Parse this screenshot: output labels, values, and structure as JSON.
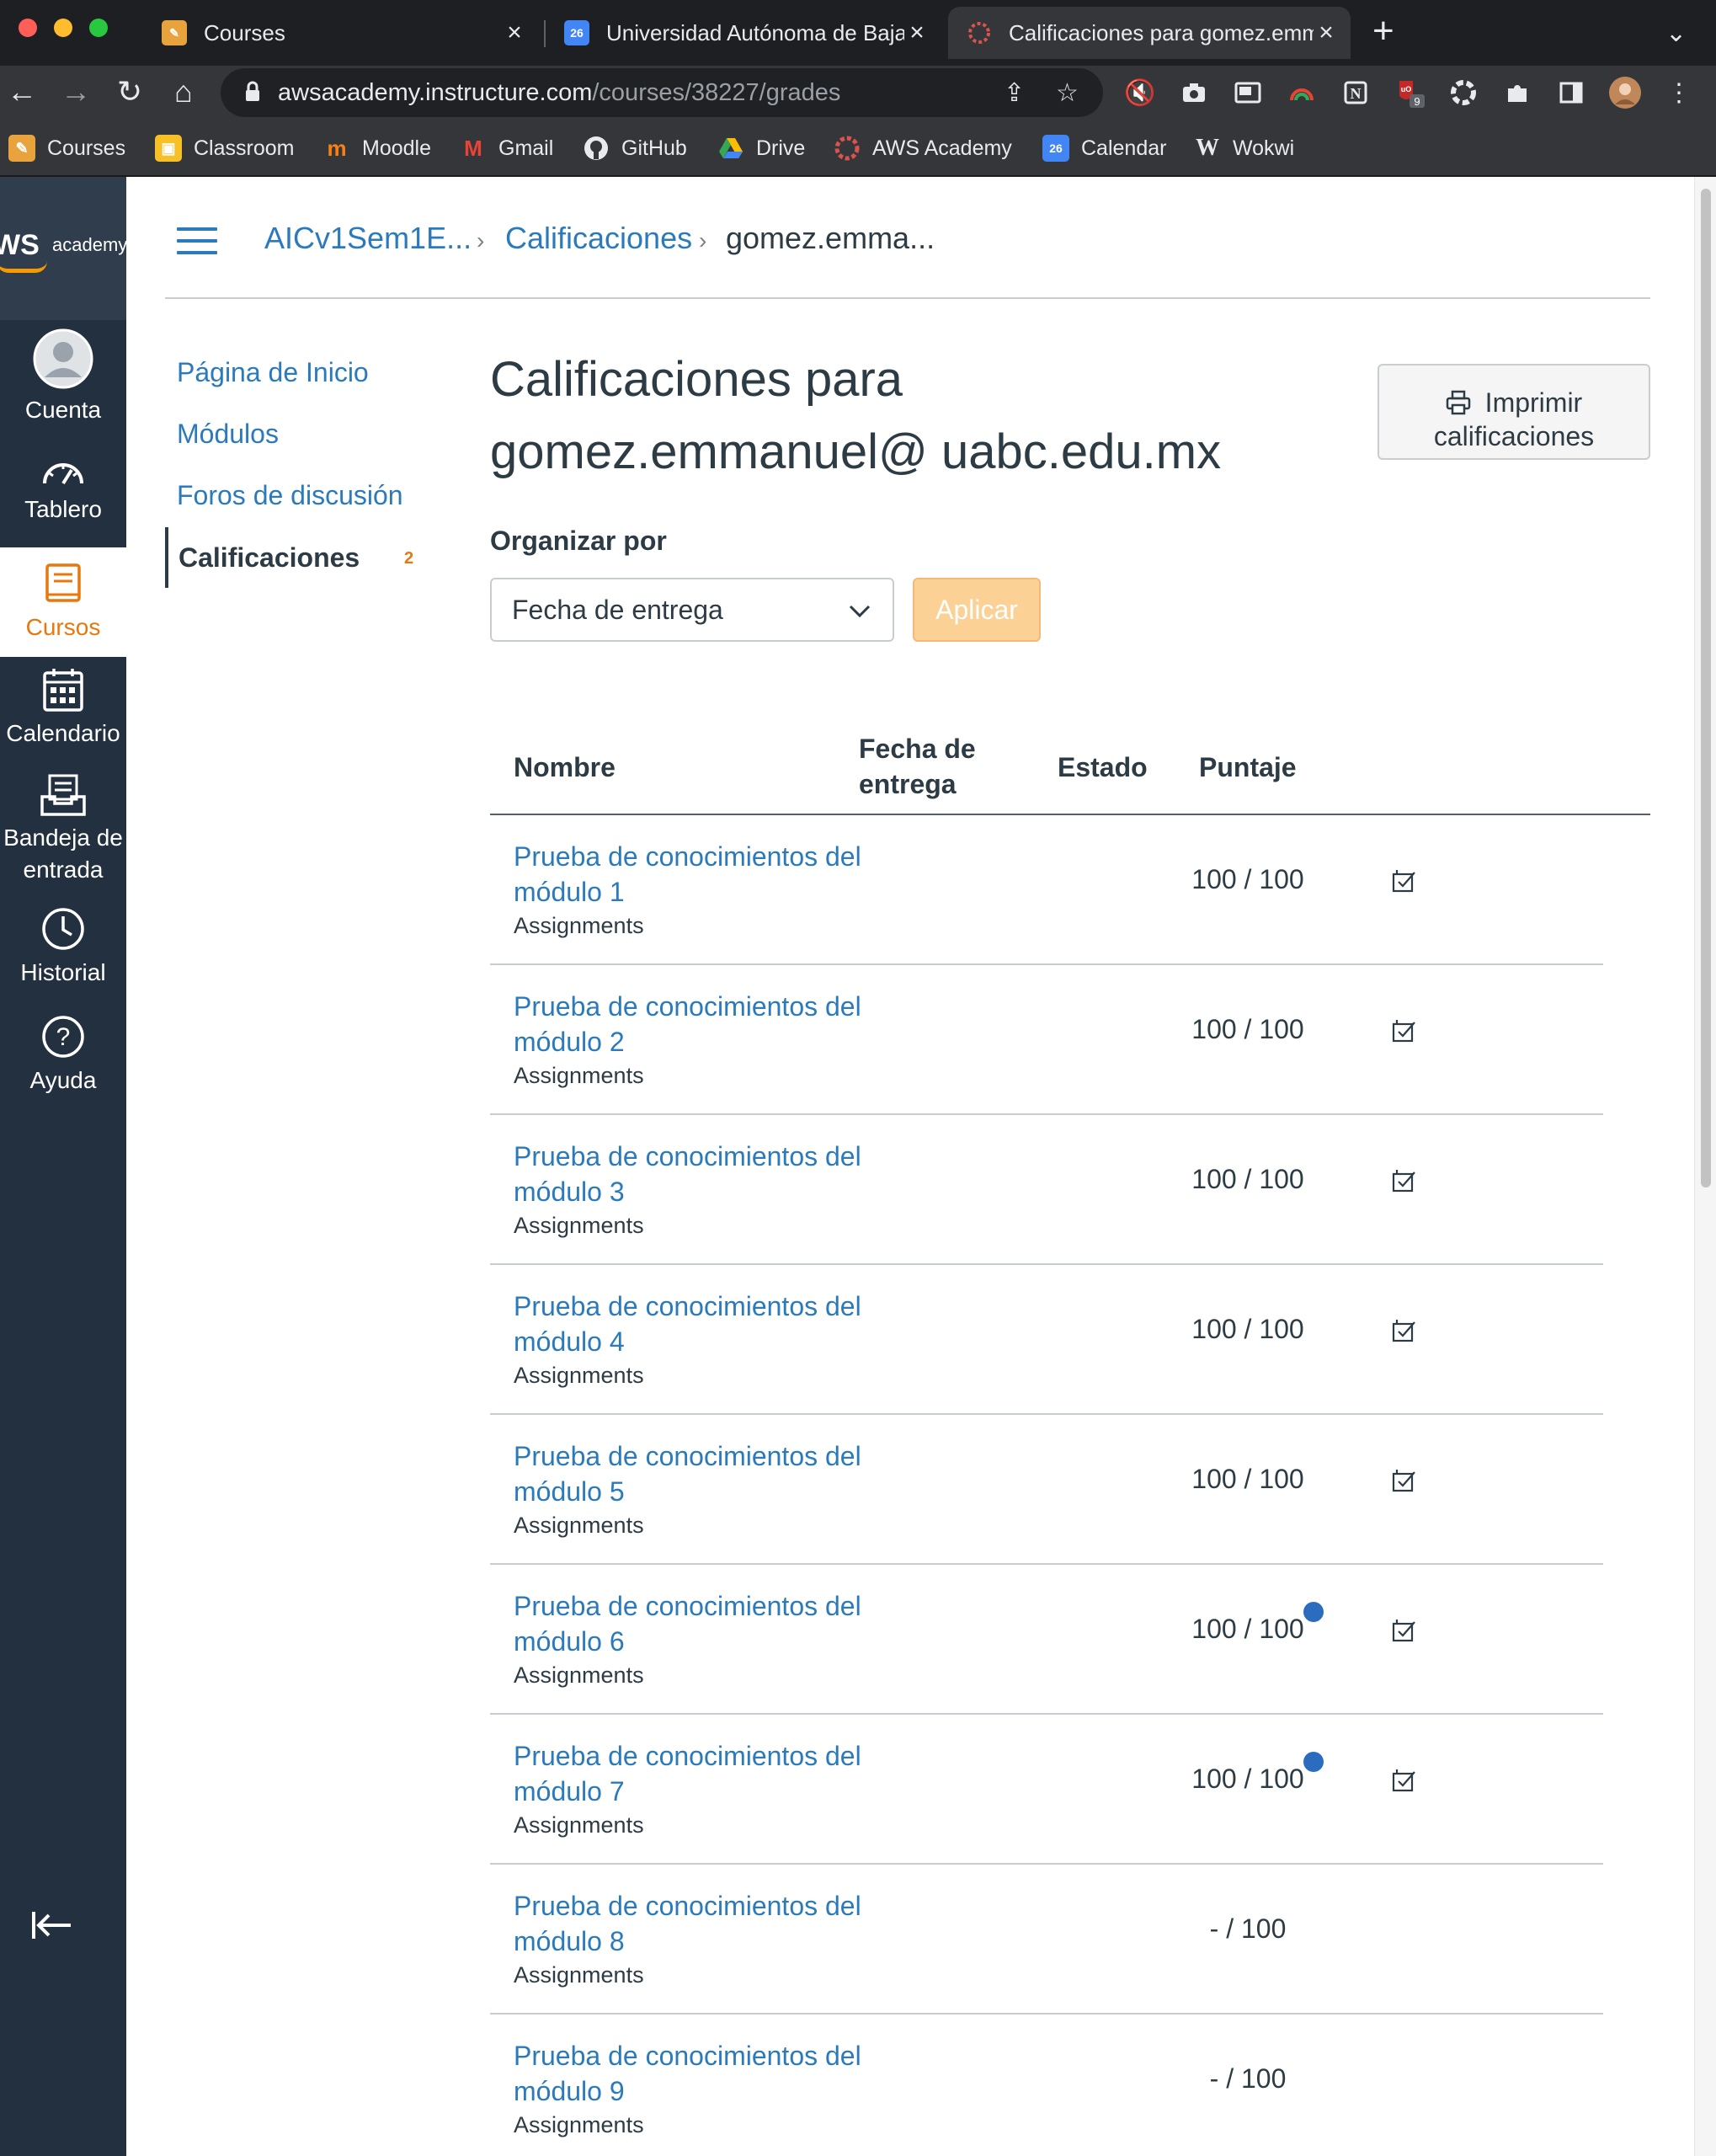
{
  "browser": {
    "tabs": [
      {
        "title": "Courses",
        "favicon_color": "#e8a33d"
      },
      {
        "title": "Universidad Autónoma de Baja",
        "favicon_color": "#4285f4",
        "favicon_text": "26"
      },
      {
        "title": "Calificaciones para gomez.emm",
        "favicon_color": "#d9534f",
        "active": true
      }
    ],
    "url_host": "awsacademy.instructure.com",
    "url_path": "/courses/38227/grades",
    "extension_badge": "9",
    "bookmarks": [
      {
        "label": "Courses",
        "icon_color": "#e8a33d"
      },
      {
        "label": "Classroom",
        "icon_color": "#f6c026"
      },
      {
        "label": "Moodle",
        "icon_color": "#f98012",
        "icon_text": "m"
      },
      {
        "label": "Gmail",
        "icon_color": "#ea4335",
        "icon_text": "M"
      },
      {
        "label": "GitHub",
        "icon_color": "#ffffff"
      },
      {
        "label": "Drive",
        "icon_color": "#34a853"
      },
      {
        "label": "AWS Academy",
        "icon_color": "#d9534f"
      },
      {
        "label": "Calendar",
        "icon_color": "#4285f4",
        "icon_text": "26"
      },
      {
        "label": "Wokwi",
        "icon_color": "#ffffff",
        "icon_text": "W"
      }
    ]
  },
  "brand": {
    "logo_word": "WS",
    "logo_sub": "academy"
  },
  "global_nav": [
    {
      "label": "Cuenta",
      "icon": "account-avatar-icon"
    },
    {
      "label": "Tablero",
      "icon": "dashboard-icon"
    },
    {
      "label": "Cursos",
      "icon": "courses-icon",
      "active": true
    },
    {
      "label": "Calendario",
      "icon": "calendar-icon"
    },
    {
      "label": "Bandeja de entrada",
      "icon": "inbox-icon"
    },
    {
      "label": "Historial",
      "icon": "history-icon"
    },
    {
      "label": "Ayuda",
      "icon": "help-icon"
    }
  ],
  "breadcrumb": {
    "course": "AICv1Sem1E...",
    "section": "Calificaciones",
    "current": "gomez.emma..."
  },
  "course_nav": [
    {
      "label": "Página de Inicio"
    },
    {
      "label": "Módulos"
    },
    {
      "label": "Foros de discusión"
    },
    {
      "label": "Calificaciones",
      "active": true,
      "badge": "2"
    }
  ],
  "page": {
    "title": "Calificaciones para gomez.emmanuel@ uabc.edu.mx",
    "print_button": "Imprimir calificaciones",
    "sort_label": "Organizar por",
    "sort_value": "Fecha de entrega",
    "apply_button": "Aplicar"
  },
  "table": {
    "headers": {
      "name": "Nombre",
      "due": "Fecha de entrega",
      "status": "Estado",
      "score": "Puntaje"
    },
    "rows": [
      {
        "name": "Prueba de conocimientos del módulo 1",
        "context": "Assignments",
        "score": "100 / 100",
        "unread": false,
        "has_action": true
      },
      {
        "name": "Prueba de conocimientos del módulo 2",
        "context": "Assignments",
        "score": "100 / 100",
        "unread": false,
        "has_action": true
      },
      {
        "name": "Prueba de conocimientos del módulo 3",
        "context": "Assignments",
        "score": "100 / 100",
        "unread": false,
        "has_action": true
      },
      {
        "name": "Prueba de conocimientos del módulo 4",
        "context": "Assignments",
        "score": "100 / 100",
        "unread": false,
        "has_action": true
      },
      {
        "name": "Prueba de conocimientos del módulo 5",
        "context": "Assignments",
        "score": "100 / 100",
        "unread": false,
        "has_action": true
      },
      {
        "name": "Prueba de conocimientos del módulo 6",
        "context": "Assignments",
        "score": "100 / 100",
        "unread": true,
        "has_action": true
      },
      {
        "name": "Prueba de conocimientos del módulo 7",
        "context": "Assignments",
        "score": "100 / 100",
        "unread": true,
        "has_action": true
      },
      {
        "name": "Prueba de conocimientos del módulo 8",
        "context": "Assignments",
        "score": "- / 100",
        "unread": false,
        "has_action": false
      },
      {
        "name": "Prueba de conocimientos del módulo 9",
        "context": "Assignments",
        "score": "- / 100",
        "unread": false,
        "has_action": false
      }
    ]
  },
  "colors": {
    "link": "#2b7abc",
    "nav_bg": "#233040",
    "accent": "#e8770d",
    "unread_dot": "#2b6cbe"
  }
}
